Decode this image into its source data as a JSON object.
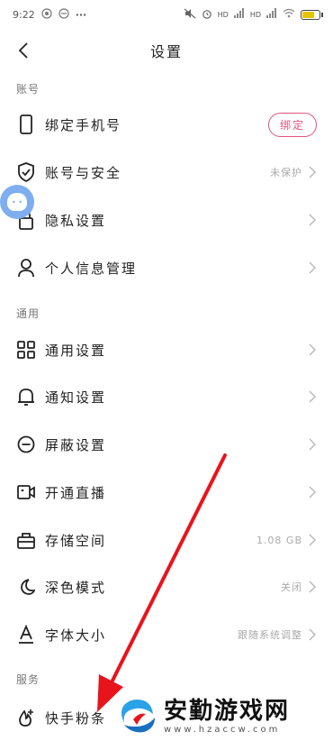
{
  "status_bar": {
    "time": "9:22",
    "signal_1": "HD",
    "signal_2": "HD",
    "overflow": "···"
  },
  "header": {
    "title": "设置"
  },
  "sections": {
    "account": "账号",
    "general": "通用",
    "service": "服务"
  },
  "rows": {
    "bind_phone": {
      "label": "绑定手机号",
      "button": "绑定"
    },
    "account_security": {
      "label": "账号与安全",
      "value": "未保护"
    },
    "privacy": {
      "label": "隐私设置"
    },
    "personal_info": {
      "label": "个人信息管理"
    },
    "general_settings": {
      "label": "通用设置"
    },
    "notification": {
      "label": "通知设置"
    },
    "block": {
      "label": "屏蔽设置"
    },
    "live": {
      "label": "开通直播"
    },
    "storage": {
      "label": "存储空间",
      "value": "1.08 GB"
    },
    "dark_mode": {
      "label": "深色模式",
      "value": "关闭"
    },
    "font_size": {
      "label": "字体大小",
      "value": "跟随系统调整"
    },
    "fan_strip": {
      "label": "快手粉条"
    }
  },
  "watermark": {
    "title": "安勤游戏网",
    "url": "www.hzaccw.com"
  },
  "colors": {
    "accent": "#e0547a",
    "arrow": "#e8141c",
    "float_ball": "#7eaef0"
  }
}
